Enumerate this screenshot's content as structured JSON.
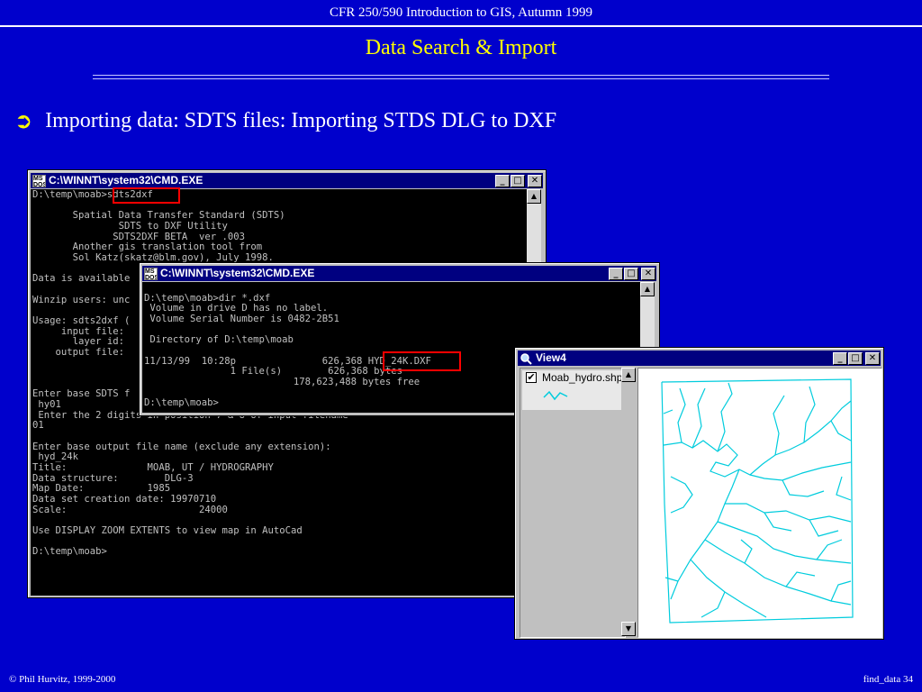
{
  "slide": {
    "header": "CFR 250/590 Introduction to GIS, Autumn 1999",
    "title": "Data Search  & Import",
    "bullet_text": "Importing data: SDTS files: Importing STDS DLG to DXF",
    "footer_left": "© Phil Hurvitz, 1999-2000",
    "footer_right": "find_data 34",
    "colors": {
      "background": "#0000cc",
      "title": "#ffff00",
      "text": "#ffffff",
      "highlight": "#ff0000",
      "map_lines": "#00ccdd"
    }
  },
  "icons": {
    "bullet": "arrow-bullet-icon",
    "console": "ms-dos-icon",
    "view": "magnifier-icon",
    "minimize": "minimize-icon",
    "maximize": "maximize-icon",
    "close": "close-icon"
  },
  "window_back": {
    "title": "C:\\WINNT\\system32\\CMD.EXE",
    "lines": [
      "D:\\temp\\moab>sdts2dxf",
      "",
      "       Spatial Data Transfer Standard (SDTS)",
      "               SDTS to DXF Utility",
      "              SDTS2DXF BETA  ver .003",
      "       Another gis translation tool from",
      "       Sol Katz(skatz@blm.gov), July 1998.",
      "",
      "Data is available",
      "",
      "Winzip users: unc",
      "",
      "Usage: sdts2dxf (",
      "     input file:",
      "       layer id:",
      "    output file:",
      "",
      "",
      "",
      "Enter base SDTS f",
      " hy01",
      " Enter the 2 digits in position 7 & 8 of input filename",
      "01",
      "",
      "Enter base output file name (exclude any extension):",
      " hyd_24k",
      "Title:              MOAB, UT / HYDROGRAPHY",
      "Data structure:        DLG-3",
      "Map Date:           1985",
      "Data set creation date: 19970710",
      "Scale:                       24000",
      "",
      "Use DISPLAY ZOOM EXTENTS to view map in AutoCad",
      "",
      "D:\\temp\\moab>"
    ]
  },
  "window_front": {
    "title": "C:\\WINNT\\system32\\CMD.EXE",
    "lines": [
      "",
      "D:\\temp\\moab>dir *.dxf",
      " Volume in drive D has no label.",
      " Volume Serial Number is 0482-2B51",
      "",
      " Directory of D:\\temp\\moab",
      "",
      "11/13/99  10:28p               626,368 HYD_24K.DXF",
      "               1 File(s)        626,368 bytes",
      "                          178,623,488 bytes free",
      "",
      "D:\\temp\\moab>"
    ]
  },
  "window_view": {
    "title": "View4",
    "legend_label": "Moab_hydro.shp",
    "legend_checked": "✔"
  }
}
